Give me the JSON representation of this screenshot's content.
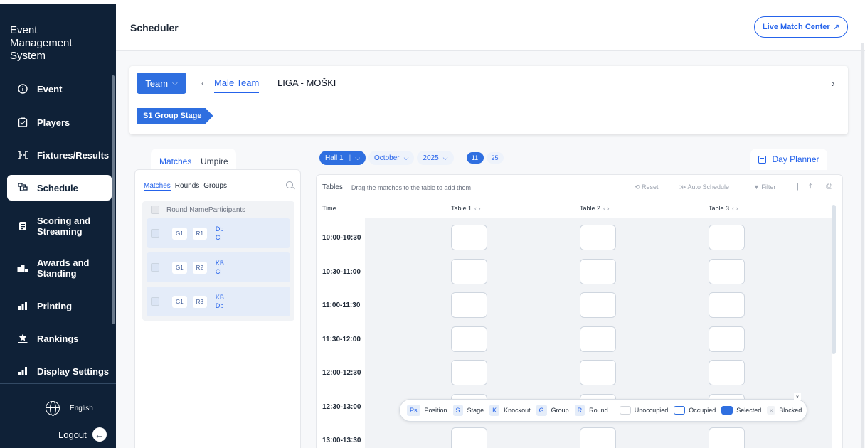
{
  "sidebar": {
    "brand": "Event Management System",
    "items": [
      {
        "label": "Event",
        "icon": "info-icon"
      },
      {
        "label": "Players",
        "icon": "clipboard-check-icon"
      },
      {
        "label": "Fixtures/Results",
        "icon": "bracket-icon"
      },
      {
        "label": "Schedule",
        "icon": "schedule-icon"
      },
      {
        "label": "Scoring and Streaming",
        "icon": "scoring-icon"
      },
      {
        "label": "Awards and Standing",
        "icon": "podium-icon"
      },
      {
        "label": "Printing",
        "icon": "printing-icon"
      },
      {
        "label": "Rankings",
        "icon": "rankings-icon"
      },
      {
        "label": "Display Settings",
        "icon": "display-settings-icon"
      }
    ],
    "active_item": "Schedule",
    "language": "English",
    "logout": "Logout"
  },
  "header": {
    "title": "Scheduler",
    "live_button": "Live Match Center"
  },
  "selector": {
    "team_button": "Team",
    "tabs": [
      "Male Team",
      "LIGA - MOŠKI"
    ],
    "active_tab": "Male Team",
    "stage_tag": "S1  Group Stage"
  },
  "left_panel": {
    "tabs": [
      "Matches",
      "Umpire"
    ],
    "active_tab": "Matches",
    "subtabs": [
      "Matches",
      "Rounds",
      "Groups"
    ],
    "active_subtab": "Matches",
    "columns": [
      "Round Name",
      "Participants"
    ],
    "matches": [
      {
        "group": "G1",
        "round": "R1",
        "participants": [
          "Db",
          "Ci"
        ]
      },
      {
        "group": "G1",
        "round": "R2",
        "participants": [
          "KB",
          "Ci"
        ]
      },
      {
        "group": "G1",
        "round": "R3",
        "participants": [
          "KB",
          "Db"
        ]
      }
    ]
  },
  "filters": {
    "hall": "Hall 1",
    "month": "October",
    "year": "2025",
    "days": [
      "11",
      "25"
    ],
    "active_day": "11"
  },
  "day_planner": {
    "label": "Day Planner"
  },
  "schedule": {
    "title": "Tables",
    "hint": "Drag the matches to the table to add them",
    "tools": {
      "reset": "Reset",
      "auto": "Auto Schedule",
      "filter": "Filter"
    },
    "time_header": "Time",
    "tables": [
      "Table 1",
      "Table 2",
      "Table 3"
    ],
    "slots": [
      "10:00-10:30",
      "10:30-11:00",
      "11:00-11:30",
      "11:30-12:00",
      "12:00-12:30",
      "12:30-13:00",
      "13:00-13:30"
    ]
  },
  "legend": {
    "keys": [
      {
        "key": "Ps",
        "label": "Position"
      },
      {
        "key": "S",
        "label": "Stage"
      },
      {
        "key": "K",
        "label": "Knockout"
      },
      {
        "key": "G",
        "label": "Group"
      },
      {
        "key": "R",
        "label": "Round"
      }
    ],
    "states": [
      "Unoccupied",
      "Occupied",
      "Selected",
      "Blocked"
    ]
  },
  "colors": {
    "accent": "#2f6fe0",
    "sidebar": "#0f2137"
  }
}
